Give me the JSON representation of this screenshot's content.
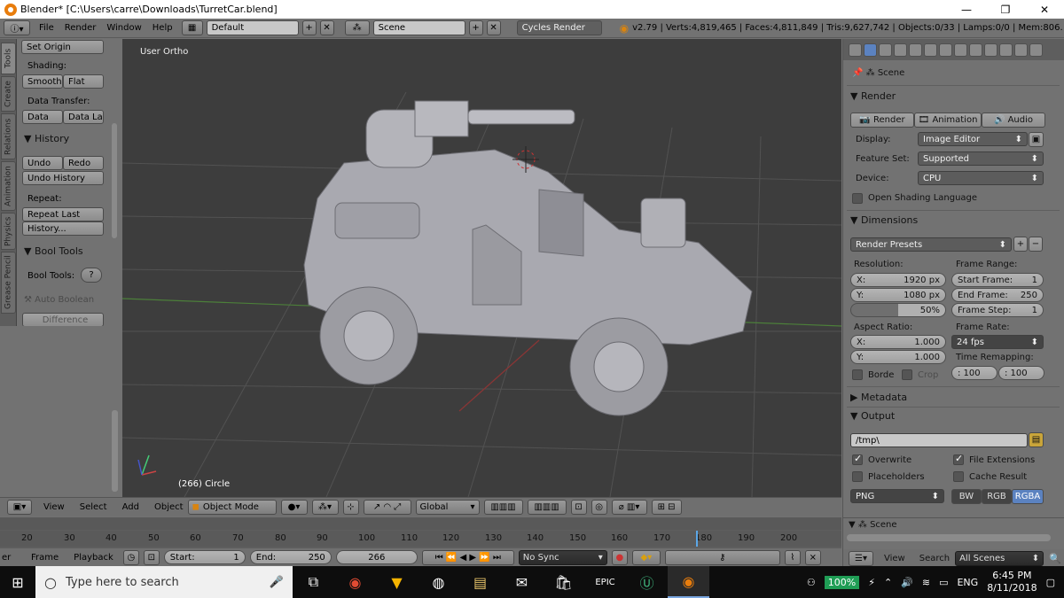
{
  "window": {
    "title": "Blender* [C:\\Users\\carre\\Downloads\\TurretCar.blend]",
    "min": "—",
    "max": "❐",
    "close": "✕"
  },
  "topbar": {
    "menus": [
      "File",
      "Render",
      "Window",
      "Help"
    ],
    "layout": "Default",
    "scene": "Scene",
    "engine": "Cycles Render",
    "stats": "v2.79 | Verts:4,819,465 | Faces:4,811,849 | Tris:9,627,742 | Objects:0/33 | Lamps:0/0 | Mem:806.73M | Circle"
  },
  "tabs": [
    "Tools",
    "Create",
    "Relations",
    "Animation",
    "Physics",
    "Grease Pencil"
  ],
  "shelf": {
    "set_origin": "Set Origin",
    "shading_label": "Shading:",
    "smooth": "Smooth",
    "flat": "Flat",
    "data_transfer_label": "Data Transfer:",
    "data": "Data",
    "data_la": "Data La",
    "history_head": "History",
    "undo": "Undo",
    "redo": "Redo",
    "undo_history": "Undo History",
    "repeat_label": "Repeat:",
    "repeat_last": "Repeat Last",
    "history_btn": "History...",
    "bool_head": "Bool Tools",
    "bool_label": "Bool Tools:",
    "auto_boolean": "Auto Boolean",
    "difference": "Difference"
  },
  "viewport": {
    "view_label": "User Ortho",
    "object_label": "(266) Circle"
  },
  "vpheader": {
    "menus": [
      "View",
      "Select",
      "Add",
      "Object"
    ],
    "mode": "Object Mode",
    "orientation": "Global"
  },
  "timeline": {
    "ticks": [
      "20",
      "30",
      "40",
      "50",
      "60",
      "70",
      "80",
      "90",
      "100",
      "110",
      "120",
      "130",
      "140",
      "150",
      "160",
      "170",
      "180",
      "190",
      "200"
    ],
    "menus": [
      "View",
      "Marker",
      "Frame",
      "Playback"
    ],
    "start_label": "Start:",
    "start_val": "1",
    "end_label": "End:",
    "end_val": "250",
    "current": "266",
    "sync": "No Sync"
  },
  "props": {
    "scene": "Scene",
    "render_head": "Render",
    "render_btn": "Render",
    "animation_btn": "Animation",
    "audio_btn": "Audio",
    "display_label": "Display:",
    "display_val": "Image Editor",
    "feature_label": "Feature Set:",
    "feature_val": "Supported",
    "device_label": "Device:",
    "device_val": "CPU",
    "osl": "Open Shading Language",
    "dim_head": "Dimensions",
    "presets": "Render Presets",
    "res_label": "Resolution:",
    "res_x_label": "X:",
    "res_x": "1920 px",
    "res_y_label": "Y:",
    "res_y": "1080 px",
    "res_pct": "50%",
    "frame_range_label": "Frame Range:",
    "start_frame_label": "Start Frame:",
    "start_frame": "1",
    "end_frame_label": "End Frame:",
    "end_frame": "250",
    "frame_step_label": "Frame Step:",
    "frame_step": "1",
    "aspect_label": "Aspect Ratio:",
    "asp_x_label": "X:",
    "asp_x": "1.000",
    "asp_y_label": "Y:",
    "asp_y": "1.000",
    "frame_rate_label": "Frame Rate:",
    "fps": "24 fps",
    "border": "Borde",
    "crop": "Crop",
    "time_remap_label": "Time Remapping:",
    "remap_old": ": 100",
    "remap_new": ": 100",
    "metadata_head": "Metadata",
    "output_head": "Output",
    "output_path": "/tmp\\",
    "overwrite": "Overwrite",
    "file_ext": "File Extensions",
    "placeholders": "Placeholders",
    "cache_result": "Cache Result",
    "format": "PNG",
    "bw": "BW",
    "rgb": "RGB",
    "rgba": "RGBA"
  },
  "outliner": {
    "scene": "Scene",
    "menus": [
      "View",
      "Search"
    ],
    "filter": "All Scenes"
  },
  "taskbar": {
    "search": "Type here to search",
    "battery": "100%",
    "lang": "ENG",
    "time": "6:45 PM",
    "date": "8/11/2018"
  }
}
